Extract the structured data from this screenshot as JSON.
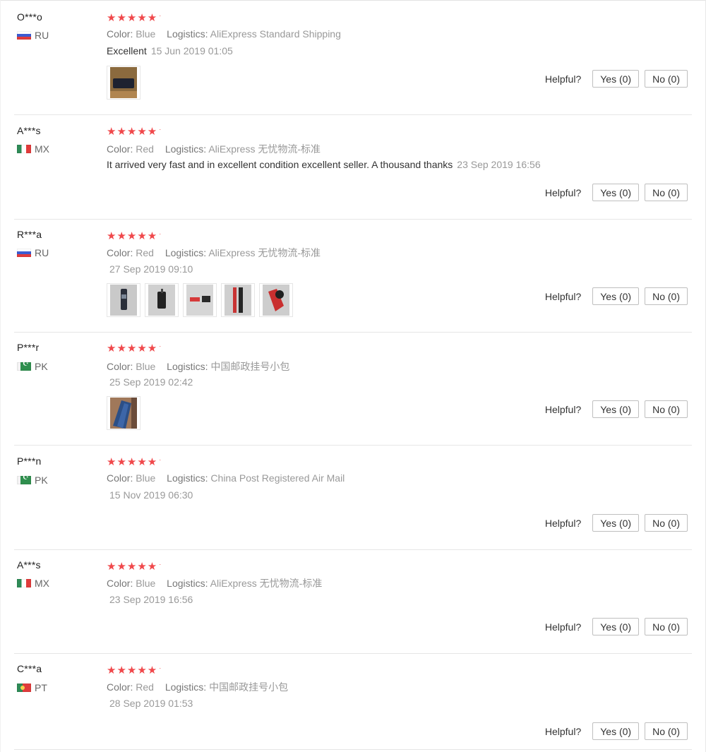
{
  "labels": {
    "color": "Color:",
    "logistics": "Logistics:",
    "helpful": "Helpful?",
    "stars": "★★★★★",
    "star_dot": "·"
  },
  "colors": {
    "star": "#f0484b",
    "separator": "#e6e6e6",
    "muted_text": "#999999"
  },
  "reviews": [
    {
      "user": "O***o",
      "country": "RU",
      "flag": "russia-flag-icon",
      "rating": 5,
      "color": "Blue",
      "logistics": "AliExpress Standard Shipping",
      "feedback": "Excellent",
      "date": "15 Jun 2019 01:05",
      "photos": 1,
      "yes": "Yes (0)",
      "no": "No (0)"
    },
    {
      "user": "A***s",
      "country": "MX",
      "flag": "mexico-flag-icon",
      "rating": 5,
      "color": "Red",
      "logistics": "AliExpress 无忧物流-标准",
      "feedback": "It arrived very fast and in excellent condition excellent seller. A thousand thanks",
      "date": "23 Sep 2019 16:56",
      "photos": 0,
      "yes": "Yes (0)",
      "no": "No (0)"
    },
    {
      "user": "R***a",
      "country": "RU",
      "flag": "russia-flag-icon",
      "rating": 5,
      "color": "Red",
      "logistics": "AliExpress 无忧物流-标准",
      "feedback": "",
      "date": "27 Sep 2019 09:10",
      "photos": 5,
      "yes": "Yes (0)",
      "no": "No (0)"
    },
    {
      "user": "P***r",
      "country": "PK",
      "flag": "pakistan-flag-icon",
      "rating": 5,
      "color": "Blue",
      "logistics": "中国邮政挂号小包",
      "feedback": "",
      "date": "25 Sep 2019 02:42",
      "photos": 1,
      "yes": "Yes (0)",
      "no": "No (0)"
    },
    {
      "user": "P***n",
      "country": "PK",
      "flag": "pakistan-flag-icon",
      "rating": 5,
      "color": "Blue",
      "logistics": "China Post Registered Air Mail",
      "feedback": "",
      "date": "15 Nov 2019 06:30",
      "photos": 0,
      "yes": "Yes (0)",
      "no": "No (0)"
    },
    {
      "user": "A***s",
      "country": "MX",
      "flag": "mexico-flag-icon",
      "rating": 5,
      "color": "Blue",
      "logistics": "AliExpress 无忧物流-标准",
      "feedback": "",
      "date": "23 Sep 2019 16:56",
      "photos": 0,
      "yes": "Yes (0)",
      "no": "No (0)"
    },
    {
      "user": "C***a",
      "country": "PT",
      "flag": "portugal-flag-icon",
      "rating": 5,
      "color": "Red",
      "logistics": "中国邮政挂号小包",
      "feedback": "",
      "date": "28 Sep 2019 01:53",
      "photos": 0,
      "yes": "Yes (0)",
      "no": "No (0)"
    }
  ]
}
